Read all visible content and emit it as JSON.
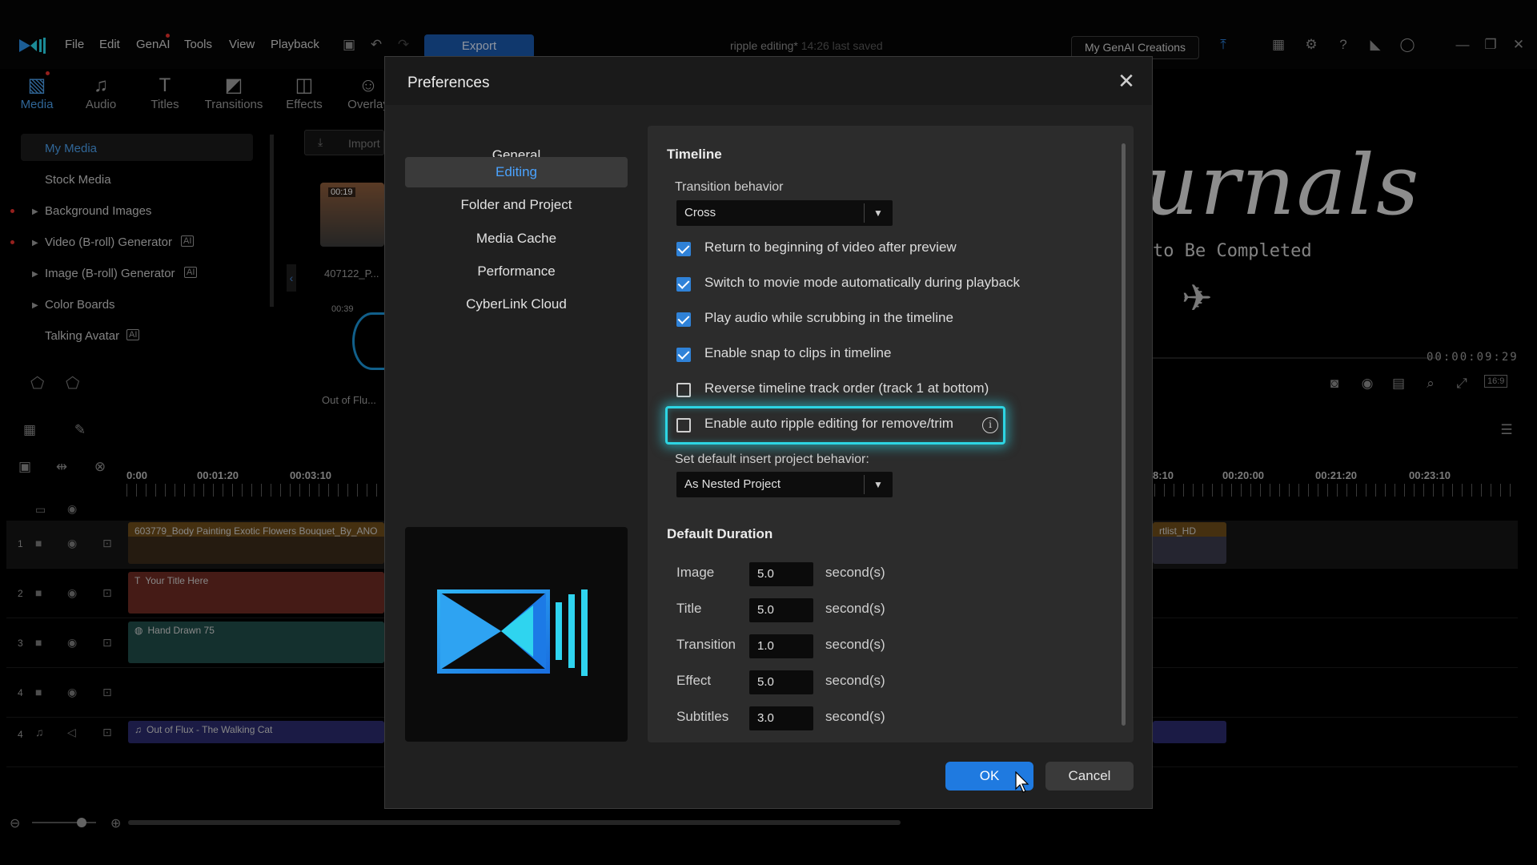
{
  "menu": {
    "items": [
      "File",
      "Edit",
      "GenAI",
      "Tools",
      "View",
      "Playback"
    ],
    "export_label": "Export",
    "doc_title": "ripple editing*",
    "doc_saved": "14:26 last saved",
    "genai_button": "My GenAI Creations"
  },
  "rooms": [
    {
      "label": "Media",
      "icon": "media-icon"
    },
    {
      "label": "Audio",
      "icon": "music-note-icon"
    },
    {
      "label": "Titles",
      "icon": "title-t-icon"
    },
    {
      "label": "Transitions",
      "icon": "transition-icon"
    },
    {
      "label": "Effects",
      "icon": "effects-icon"
    },
    {
      "label": "Overlay",
      "icon": "overlay-icon"
    }
  ],
  "library": {
    "items": [
      "My Media",
      "Stock Media",
      "Background Images",
      "Video (B-roll) Generator",
      "Image (B-roll) Generator",
      "Color Boards",
      "Talking Avatar"
    ],
    "import_label": "Import",
    "thumb1_duration": "00:19",
    "thumb1_name": "407122_P...",
    "thumb2_duration": "00:39",
    "thumb2_name": "Out of Flu..."
  },
  "preview": {
    "title_text": "urnals",
    "subtitle_text": "to Be Completed",
    "timecode": "00:00:09:29",
    "aspect": "16:9"
  },
  "timeline": {
    "ruler_left": [
      "0:00",
      "00:01:20",
      "00:03:10"
    ],
    "ruler_right": [
      "8:10",
      "00:20:00",
      "00:21:20",
      "00:23:10"
    ],
    "tracks": [
      {
        "num": "1",
        "clip": "603779_Body Painting Exotic Flowers Bouquet_By_ANO",
        "clip_right": "rtlist_HD"
      },
      {
        "num": "2",
        "clip": "Your Title Here"
      },
      {
        "num": "3",
        "clip": "Hand Drawn 75"
      },
      {
        "num": "4",
        "clip": ""
      },
      {
        "num": "4",
        "clip": "Out of Flux - The Walking Cat"
      }
    ]
  },
  "dialog": {
    "title": "Preferences",
    "nav": [
      "General",
      "Editing",
      "Folder and Project",
      "Media Cache",
      "Performance",
      "CyberLink Cloud"
    ],
    "active_nav": "Editing",
    "timeline_section": "Timeline",
    "transition_behavior_label": "Transition behavior",
    "transition_behavior_value": "Cross",
    "checkboxes": [
      {
        "label": "Return to beginning of video after preview",
        "checked": true
      },
      {
        "label": "Switch to movie mode automatically during playback",
        "checked": true
      },
      {
        "label": "Play audio while scrubbing in the timeline",
        "checked": true
      },
      {
        "label": "Enable snap to clips in timeline",
        "checked": true
      },
      {
        "label": "Reverse timeline track order (track 1 at bottom)",
        "checked": false
      },
      {
        "label": "Enable auto ripple editing for remove/trim",
        "checked": false
      }
    ],
    "insert_behavior_label": "Set default insert project behavior:",
    "insert_behavior_value": "As Nested Project",
    "duration_section": "Default Duration",
    "durations": [
      {
        "label": "Image",
        "value": "5.0",
        "unit": "second(s)"
      },
      {
        "label": "Title",
        "value": "5.0",
        "unit": "second(s)"
      },
      {
        "label": "Transition",
        "value": "1.0",
        "unit": "second(s)"
      },
      {
        "label": "Effect",
        "value": "5.0",
        "unit": "second(s)"
      },
      {
        "label": "Subtitles",
        "value": "3.0",
        "unit": "second(s)"
      }
    ],
    "ok_label": "OK",
    "cancel_label": "Cancel"
  },
  "colors": {
    "accent": "#1f7ae0",
    "highlight": "#2dd5e3",
    "active_text": "#4aa3ff"
  }
}
